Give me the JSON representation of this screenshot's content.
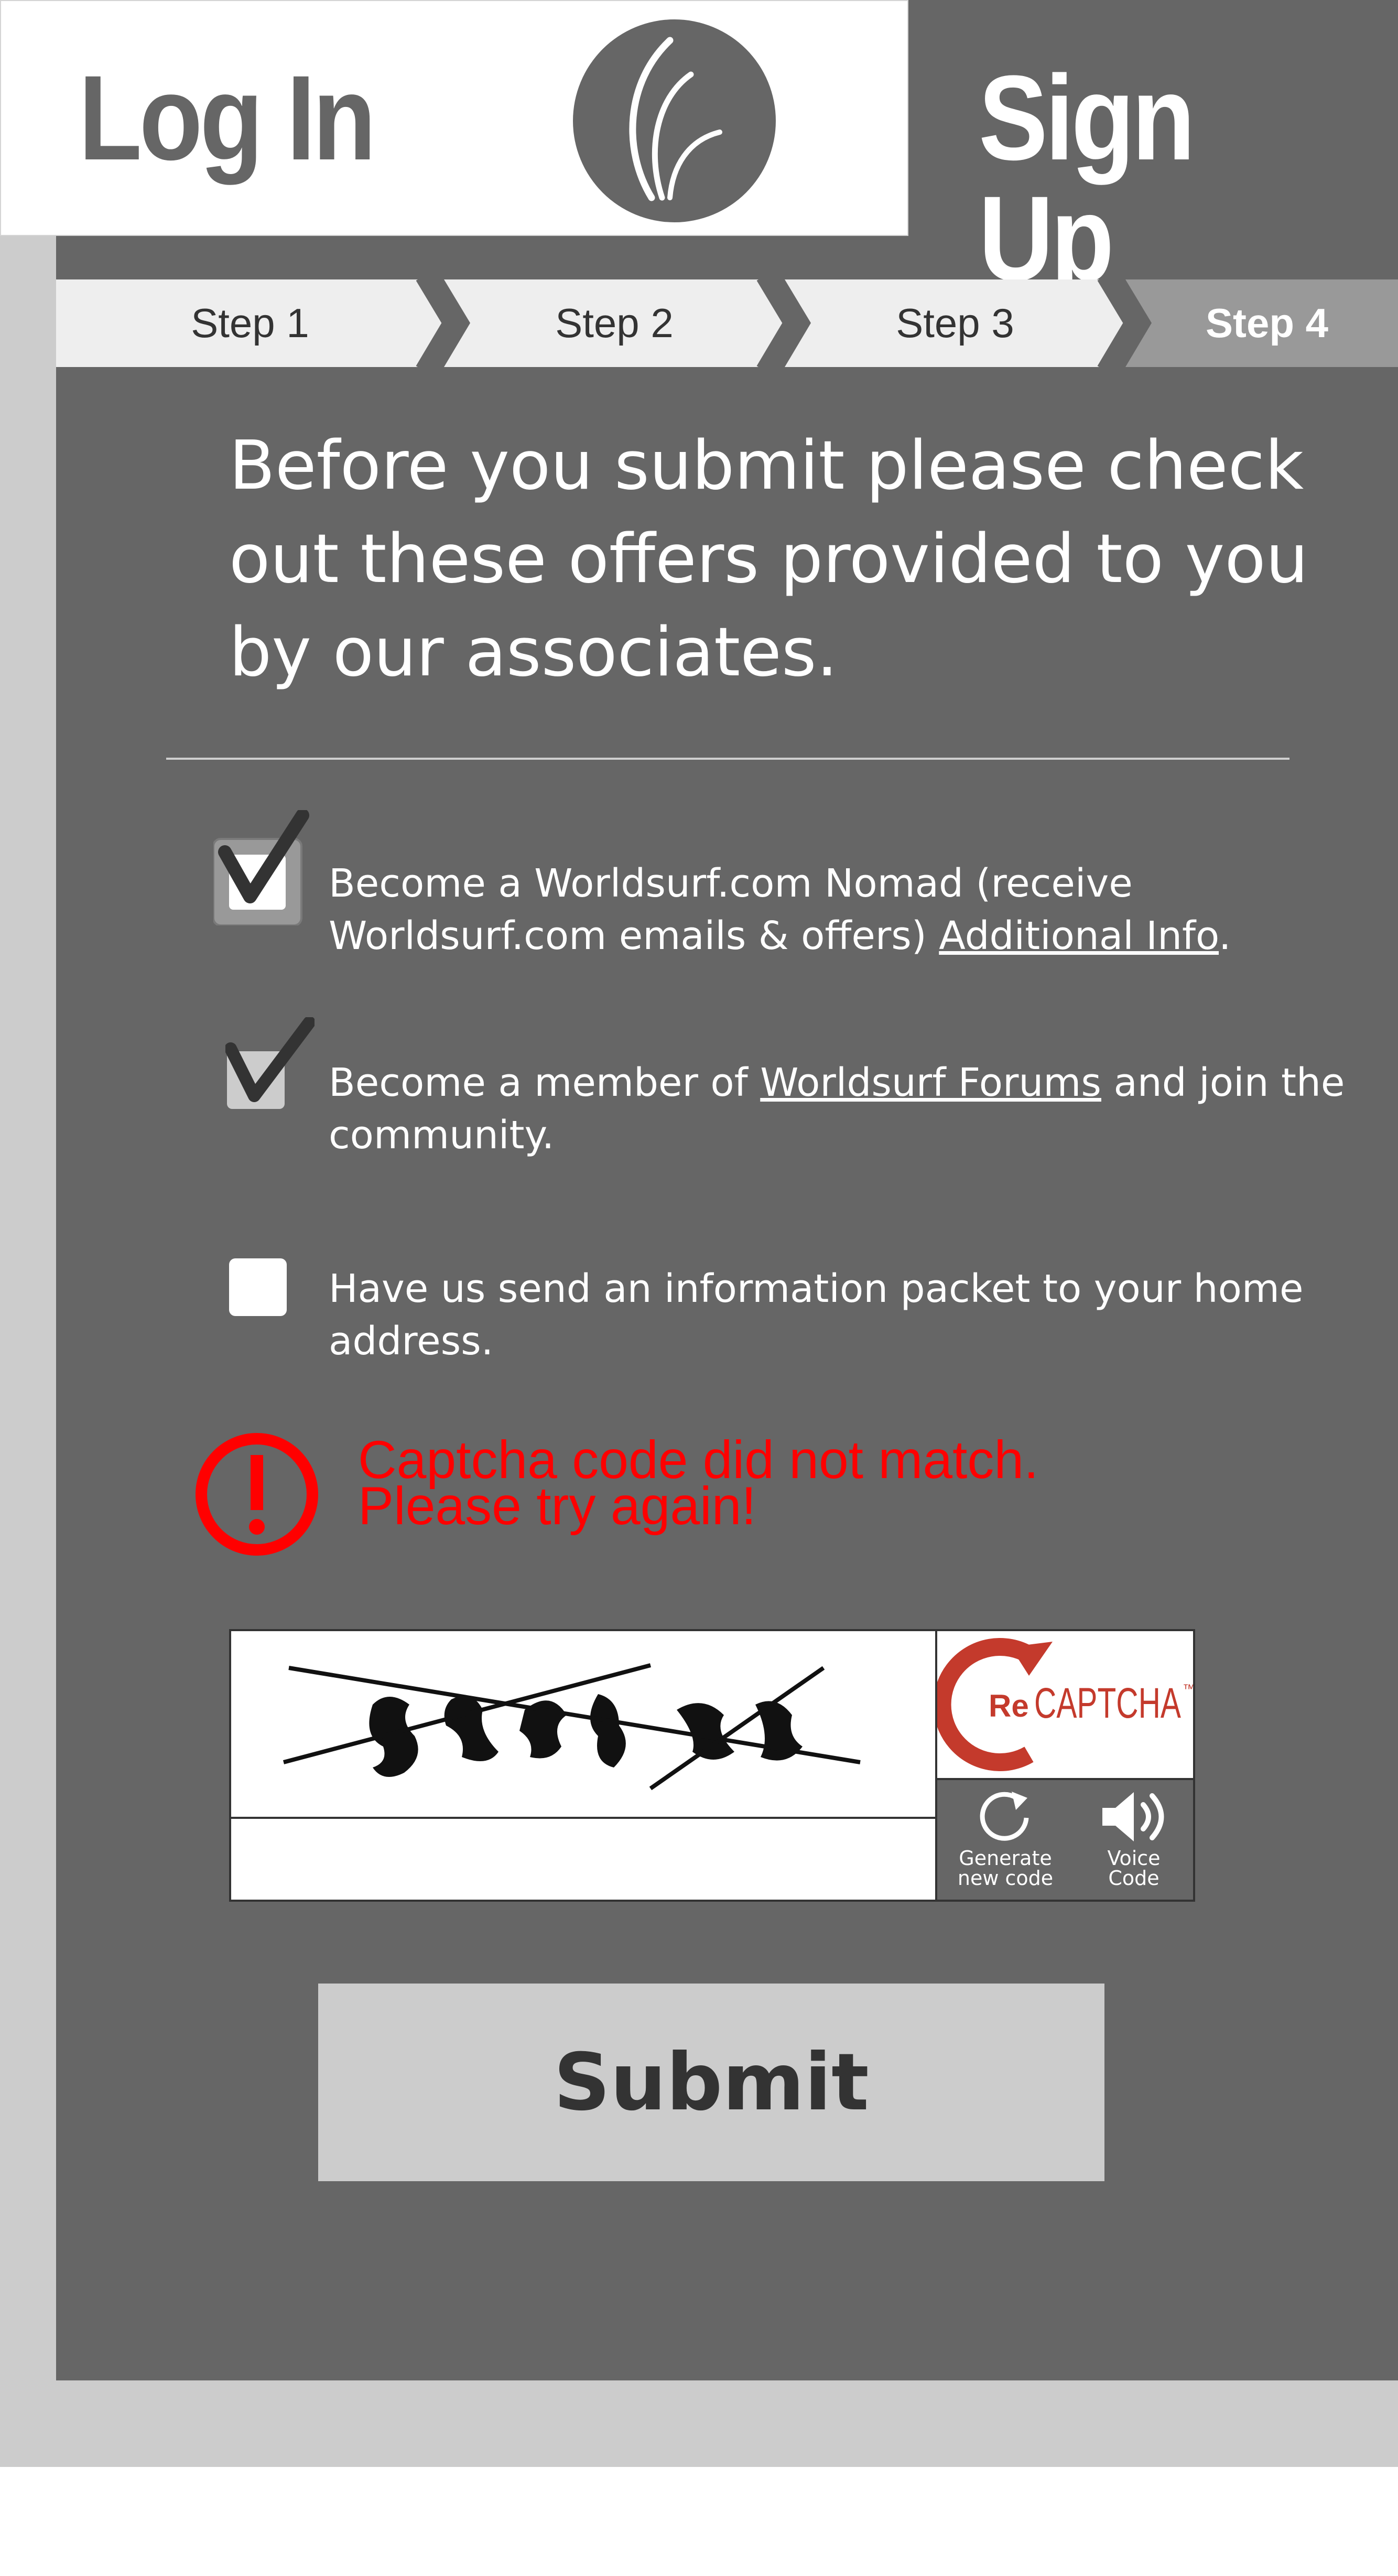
{
  "header": {
    "login_label": "Log In",
    "signup_label": "Sign Up",
    "logo_icon": "worldsurf-logo-icon"
  },
  "steps": [
    {
      "label": "Step 1",
      "active": false
    },
    {
      "label": "Step 2",
      "active": false
    },
    {
      "label": "Step 3",
      "active": false
    },
    {
      "label": "Step 4",
      "active": true
    }
  ],
  "heading": "Before you submit please check out these offers provided to you by our associates.",
  "options": [
    {
      "checked": true,
      "text_before": "Become a Worldsurf.com Nomad (receive Worldsurf.com emails & offers) ",
      "link": "Additional Info",
      "text_after": "."
    },
    {
      "checked": true,
      "text_before": "Become a member of ",
      "link": "Worldsurf Forums",
      "text_after": " and join the community."
    },
    {
      "checked": false,
      "text_before": "Have us send an information packet to your home address.",
      "link": "",
      "text_after": ""
    }
  ],
  "error": {
    "line1": "Captcha code did not match.",
    "line2": "Please try again!",
    "icon": "exclamation-circle-icon"
  },
  "captcha": {
    "input_value": "",
    "brand_prefix": "Re",
    "brand_name": "CAPTCHA",
    "brand_tm": "™",
    "generate_label_1": "Generate",
    "generate_label_2": "new code",
    "voice_label_1": "Voice",
    "voice_label_2": "Code"
  },
  "submit_label": "Submit",
  "colors": {
    "panel": "#666666",
    "frame": "#cccccc",
    "error": "#ff0000",
    "recaptcha_red": "#c43a2c",
    "active_step": "#999999",
    "inactive_step": "#eeeeee"
  }
}
